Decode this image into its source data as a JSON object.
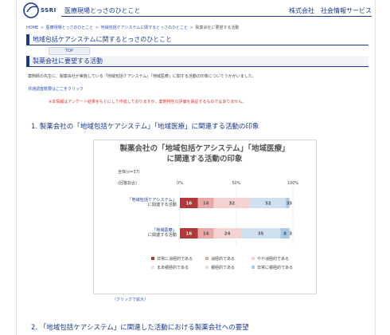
{
  "header": {
    "logo_text": "SSRI",
    "site_title": "医療現場とっさのひとこと",
    "company": "株式会社　社会情報サービス"
  },
  "breadcrumb": {
    "items": [
      "HOME",
      "医療現場とっさのひとこと",
      "地域包括ケアシステムに関するとっさのひとこと"
    ],
    "current": "製薬会社に要望する活動",
    "separator": ">"
  },
  "page_title": "地域包括ケアシステムに関するとっさのひとこと",
  "top_tab": "TOP",
  "section_heading": "製薬会社に要望する活動",
  "intro": "薬剤師の先生に、製薬会社が実施している「地域包括ケアシステム」「地域医療」に関する活動の印象についてうかがいました。",
  "common_link": "共通調査概要はここをクリック",
  "notice": "※本情報はアンケート結果をもとにして作成しておりますが、薬剤特性の評価を保証するものではありません。",
  "section1_title": "1. 製薬会社の「地域包括ケアシステム」「地域医療」に関連する活動の印象",
  "section2_title": "2. 「地域包括ケアシステム」に関連した活動における製薬会社への要望",
  "click_note": "（クリックで拡大）",
  "colors": {
    "brand": "#1a3a8c",
    "link": "#2a50b0",
    "notice": "#e03030"
  },
  "chart_data": {
    "type": "bar",
    "orientation": "horizontal-stacked-100",
    "title_line1": "製薬会社の「地域包括ケアシステム」「地域医療」",
    "title_line2": "に関連する活動の印象",
    "base_label": "全体(n=37)",
    "unit_label": "(回答割合)",
    "ticks": [
      "0%",
      "50%",
      "100%"
    ],
    "xlim": [
      0,
      100
    ],
    "categories": [
      {
        "line1": "「地域包括ケアシステム」",
        "line2": "に関連する活動"
      },
      {
        "line1": "「地域医療」",
        "line2": "に関連する活動"
      }
    ],
    "series": [
      {
        "name": "非常に消極的である",
        "color": "#b03a3a",
        "values": [
          16,
          16
        ],
        "label_color": "#ffffff"
      },
      {
        "name": "消極的である",
        "color": "#e8a8a8",
        "values": [
          14,
          14
        ],
        "label_color": "#555555"
      },
      {
        "name": "やや消極的である",
        "color": "#f3d2d2",
        "values": [
          32,
          24
        ],
        "label_color": "#555555"
      },
      {
        "name": "まあ積極的である",
        "color": "#e4e4e4",
        "values": [
          0,
          0
        ],
        "label_color": "#555555"
      },
      {
        "name": "積極的である",
        "color": "#cfe0f0",
        "values": [
          32,
          35
        ],
        "label_color": "#555555"
      },
      {
        "name": "非常に積極的である",
        "color": "#a9c8e6",
        "values": [
          3,
          8
        ],
        "label_color": "#555555"
      }
    ],
    "segment_labels": [
      [
        "16",
        "14",
        "32",
        "",
        "32",
        "3"
      ],
      [
        "16",
        "14",
        "24",
        "",
        "35",
        "8"
      ]
    ],
    "extra_label": [
      "3",
      "3"
    ],
    "grid": true,
    "legend_placement": "bottom"
  }
}
